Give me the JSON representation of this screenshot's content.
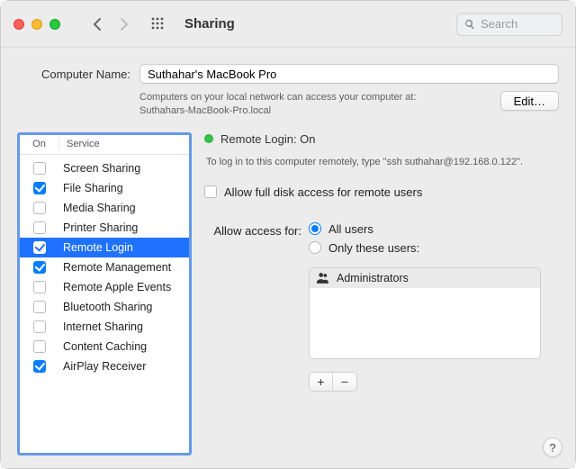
{
  "window": {
    "title": "Sharing",
    "search_placeholder": "Search"
  },
  "computer_name": {
    "label": "Computer Name:",
    "value": "Suthahar's MacBook Pro",
    "help_line1": "Computers on your local network can access your computer at:",
    "help_line2": "Suthahars-MacBook-Pro.local",
    "edit_label": "Edit…"
  },
  "service_table": {
    "col_on_label": "On",
    "col_service_label": "Service",
    "rows": [
      {
        "on": false,
        "label": "Screen Sharing"
      },
      {
        "on": true,
        "label": "File Sharing"
      },
      {
        "on": false,
        "label": "Media Sharing"
      },
      {
        "on": false,
        "label": "Printer Sharing"
      },
      {
        "on": true,
        "label": "Remote Login"
      },
      {
        "on": true,
        "label": "Remote Management"
      },
      {
        "on": false,
        "label": "Remote Apple Events"
      },
      {
        "on": false,
        "label": "Bluetooth Sharing"
      },
      {
        "on": false,
        "label": "Internet Sharing"
      },
      {
        "on": false,
        "label": "Content Caching"
      },
      {
        "on": true,
        "label": "AirPlay Receiver"
      }
    ],
    "selected_index": 4
  },
  "detail": {
    "status_title": "Remote Login: On",
    "status_color": "#33c24a",
    "status_help": "To log in to this computer remotely, type \"ssh suthahar@192.168.0.122\".",
    "full_disk_checked": false,
    "full_disk_label": "Allow full disk access for remote users",
    "access_label": "Allow access for:",
    "access_option_all": "All users",
    "access_option_listed": "Only these users:",
    "access_selected": "all",
    "users": [
      {
        "label": "Administrators"
      }
    ],
    "add_label": "+",
    "remove_label": "−",
    "help_label": "?"
  }
}
